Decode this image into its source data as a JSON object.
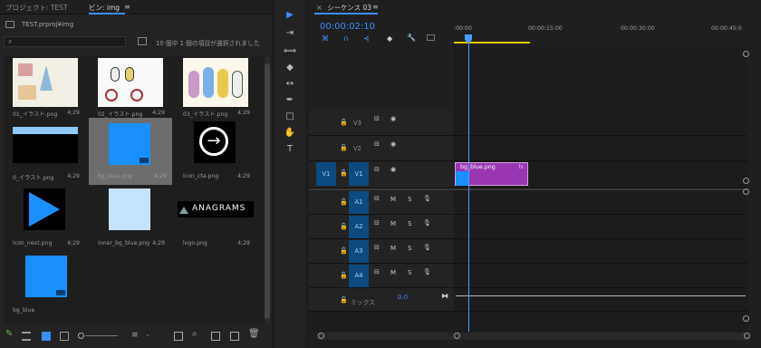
{
  "project": {
    "tab_project": "プロジェクト: TEST",
    "tab_bin": "ビン: img",
    "menu_icon": "hamburger-icon",
    "path": "TEST.prproj¥img",
    "search_placeholder": "",
    "selection_status": "10 個中 1 個の項目が選択されました",
    "items": [
      {
        "name": "01_イラスト.png",
        "dur": "4;29",
        "kind": "illust1"
      },
      {
        "name": "02_イラスト.png",
        "dur": "4;29",
        "kind": "illust2"
      },
      {
        "name": "03_イラスト.png",
        "dur": "4;29",
        "kind": "illust3"
      },
      {
        "name": "0_イラスト.png",
        "dur": "4;29",
        "kind": "black"
      },
      {
        "name": "bg_blue.png",
        "dur": "4;29",
        "kind": "blue",
        "selected": true
      },
      {
        "name": "icon_cta.png",
        "dur": "4;29",
        "kind": "cta"
      },
      {
        "name": "icon_next.png",
        "dur": "4;29",
        "kind": "next"
      },
      {
        "name": "inner_bg_blue.png",
        "dur": "4;29",
        "kind": "lightblue"
      },
      {
        "name": "logo.png",
        "dur": "4;29",
        "kind": "logo"
      },
      {
        "name": "bg_blue",
        "dur": "",
        "kind": "blueseq"
      }
    ],
    "logo_text": "ANAGRAMS"
  },
  "timeline": {
    "tab": "シーケンス 03",
    "timecode": "00:00:02:10",
    "ruler": [
      ":00:00",
      "00:00:15:00",
      "00:00:30:00",
      "00:00:45:0"
    ],
    "video_tracks": [
      {
        "label": "V3",
        "source": ""
      },
      {
        "label": "V2",
        "source": ""
      },
      {
        "label": "V1",
        "source": "V1"
      }
    ],
    "audio_tracks": [
      {
        "label": "A1",
        "m": "M",
        "s": "S"
      },
      {
        "label": "A2",
        "m": "M",
        "s": "S"
      },
      {
        "label": "A3",
        "m": "M",
        "s": "S"
      },
      {
        "label": "A4",
        "m": "M",
        "s": "S"
      }
    ],
    "mix_label": "ミックス",
    "mix_value": "0.0",
    "clip_label": "bg_blue.png",
    "clip_fx": "fx"
  },
  "colors": {
    "accent": "#3d8dff",
    "clip": "#9a36b2",
    "selected_thumb": "#6d6d6d"
  }
}
